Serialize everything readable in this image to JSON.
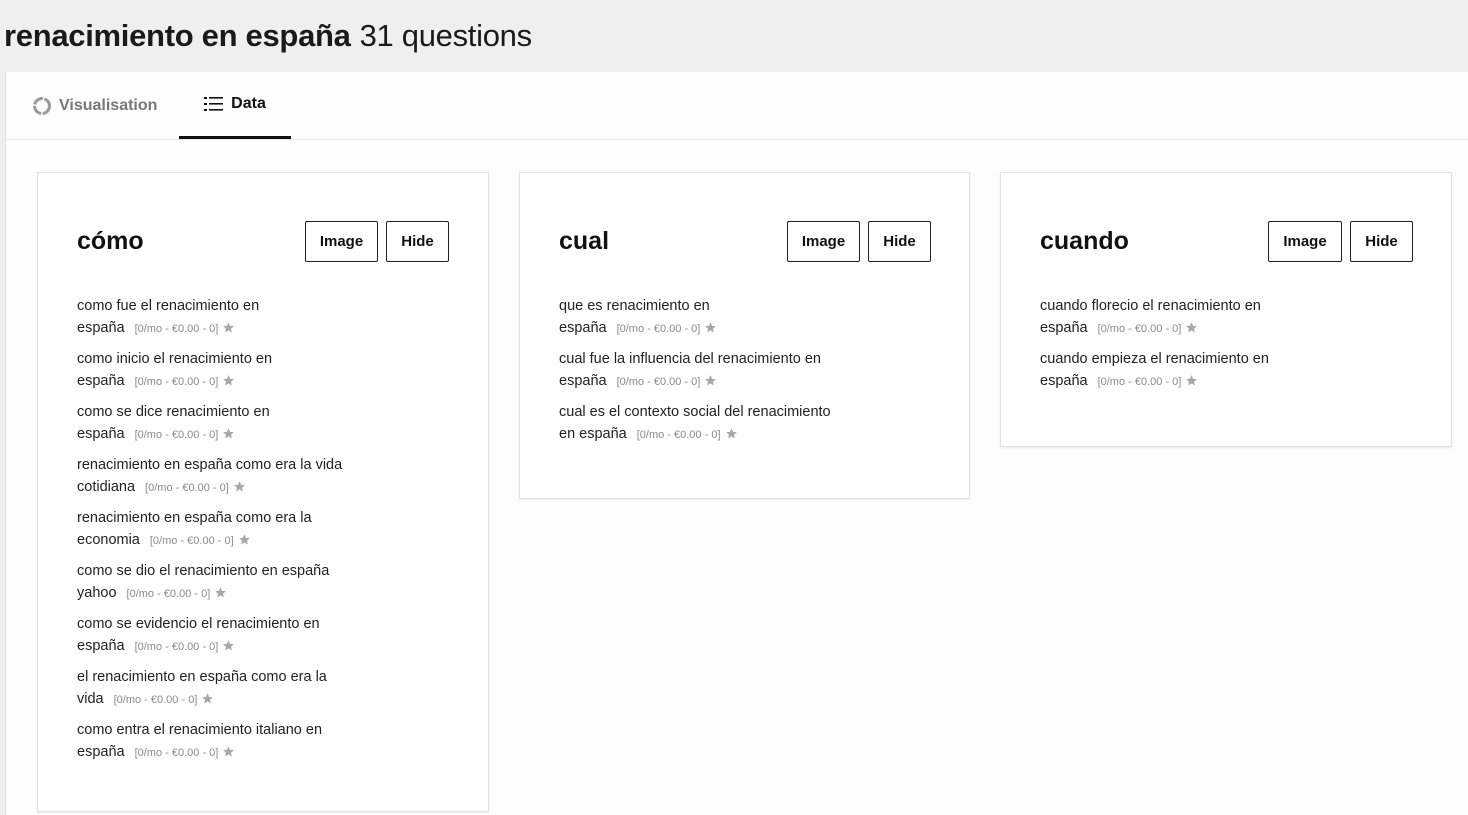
{
  "header": {
    "title": "renacimiento en españa",
    "count": "31 questions"
  },
  "tabs": [
    {
      "label": "Visualisation"
    },
    {
      "label": "Data"
    }
  ],
  "buttons": {
    "image": "Image",
    "hide": "Hide"
  },
  "groups": [
    {
      "title": "cómo",
      "items": [
        {
          "text": "como fue el renacimiento en españa",
          "meta": "[0/mo - €0.00 - 0]"
        },
        {
          "text": "como inicio el renacimiento en españa",
          "meta": "[0/mo - €0.00 - 0]"
        },
        {
          "text": "como se dice renacimiento en españa",
          "meta": "[0/mo - €0.00 - 0]"
        },
        {
          "text": "renacimiento en españa como era la vida cotidiana",
          "meta": "[0/mo - €0.00 - 0]"
        },
        {
          "text": "renacimiento en españa como era la economia",
          "meta": "[0/mo - €0.00 - 0]"
        },
        {
          "text": "como se dio el renacimiento en españa yahoo",
          "meta": "[0/mo - €0.00 - 0]"
        },
        {
          "text": "como se evidencio el renacimiento en españa",
          "meta": "[0/mo - €0.00 - 0]"
        },
        {
          "text": "el renacimiento en españa como era la vida",
          "meta": "[0/mo - €0.00 - 0]"
        },
        {
          "text": "como entra el renacimiento italiano en españa",
          "meta": "[0/mo - €0.00 - 0]"
        }
      ]
    },
    {
      "title": "cual",
      "items": [
        {
          "text": "que es renacimiento en españa",
          "meta": "[0/mo - €0.00 - 0]"
        },
        {
          "text": "cual fue la influencia del renacimiento en españa",
          "meta": "[0/mo - €0.00 - 0]"
        },
        {
          "text": "cual es el contexto social del renacimiento en españa",
          "meta": "[0/mo - €0.00 - 0]"
        }
      ]
    },
    {
      "title": "cuando",
      "items": [
        {
          "text": "cuando florecio el renacimiento en españa",
          "meta": "[0/mo - €0.00 - 0]"
        },
        {
          "text": "cuando empieza el renacimiento en españa",
          "meta": "[0/mo - €0.00 - 0]"
        }
      ]
    }
  ],
  "icons": {
    "visualisation": "donut-chart-icon",
    "data": "list-icon",
    "favorite": "star-icon"
  },
  "colors": {
    "accent": "#111111",
    "muted": "#8a8a8a",
    "star": "#a8a8a8"
  }
}
